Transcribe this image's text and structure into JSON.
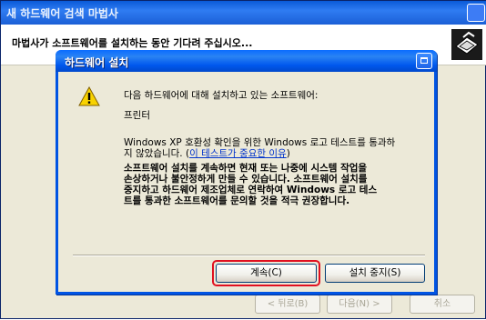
{
  "outer_window": {
    "title": "새 하드웨어 검색 마법사",
    "header_subtitle": "마법사가 소프트웨어를 설치하는 동안 기다려 주십시오...",
    "buttons": {
      "back": "< 뒤로(B)",
      "next": "다음(N) >",
      "cancel": "취소"
    }
  },
  "dialog": {
    "title": "하드웨어 설치",
    "message_intro": "다음 하드웨어에 대해 설치하고 있는 소프트웨어:",
    "device_name": "프린터",
    "logo_test_line1": "Windows XP 호환성 확인을 위한 Windows 로고 테스트를 통과하",
    "logo_test_line2_prefix": "지 않았습니다. (",
    "logo_test_link": "이 테스트가 중요한 이유",
    "logo_test_line2_suffix": ")",
    "warning_lines": [
      "소프트웨어 설치를 계속하면 현재 또는 나중에 시스템 작업을",
      "손상하거나 불안정하게 만들 수 있습니다. 소프트웨어 설치를",
      "중지하고 하드웨어 제조업체로 연락하여 Windows 로고 테스",
      "트를 통과한 소프트웨어를 문의할 것을 적극 권장합니다."
    ],
    "buttons": {
      "continue": "계속(C)",
      "stop": "설치 중지(S)"
    }
  },
  "colors": {
    "titlebar": "#0058ee",
    "dialog_bg": "#ece9d8",
    "highlight_ring": "#e01020",
    "link": "#0033cc"
  }
}
